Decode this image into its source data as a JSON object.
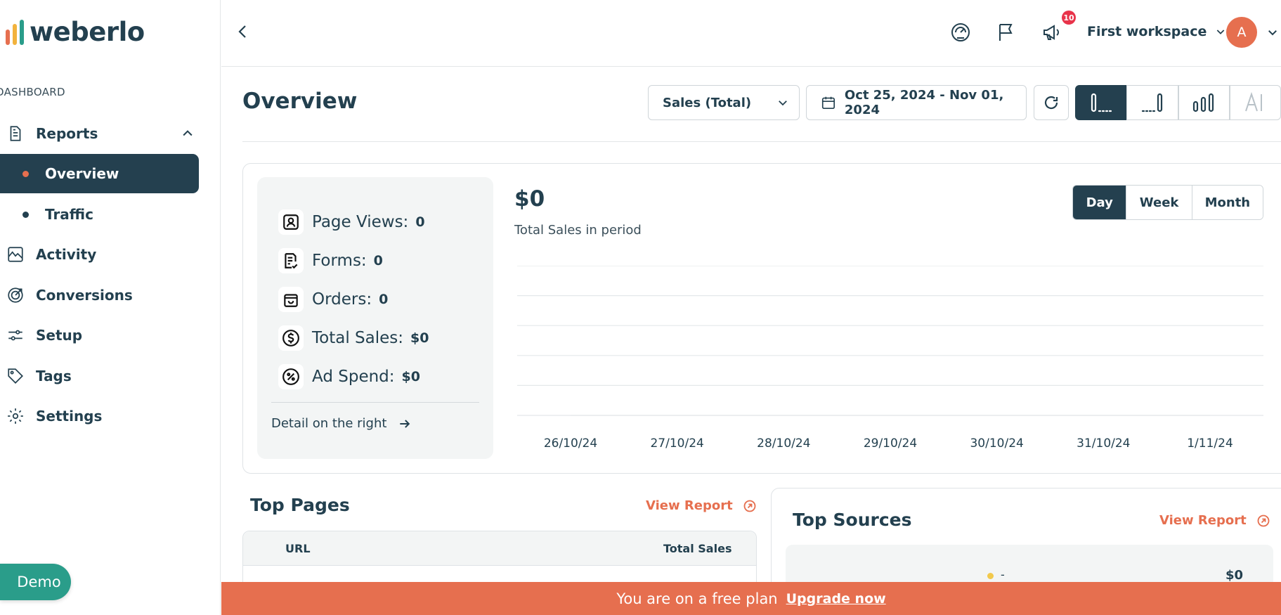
{
  "brand": {
    "name": "weberlo",
    "bar_colors": [
      "#e66f4f",
      "#f2b33d",
      "#2a9d8a"
    ]
  },
  "sidebar": {
    "section_label": "DASHBOARD",
    "items": [
      {
        "label": "Reports",
        "icon": "document-icon",
        "expanded": true
      },
      {
        "label": "Overview",
        "active": true
      },
      {
        "label": "Traffic"
      },
      {
        "label": "Activity",
        "icon": "activity-chart-icon"
      },
      {
        "label": "Conversions",
        "icon": "target-icon"
      },
      {
        "label": "Setup",
        "icon": "sliders-icon"
      },
      {
        "label": "Tags",
        "icon": "tag-icon"
      },
      {
        "label": "Settings",
        "icon": "gear-icon"
      }
    ],
    "demo_label": "Demo"
  },
  "header": {
    "notification_count": "10",
    "workspace": "First workspace",
    "avatar_initial": "A"
  },
  "page": {
    "title": "Overview",
    "metric_select": "Sales (Total)",
    "date_range": "Oct 25, 2024 - Nov 01, 2024",
    "view_options": [
      "first-bar",
      "last-bar",
      "all-bars",
      "AI"
    ]
  },
  "stats": [
    {
      "label": "Page Views:",
      "value": "0",
      "icon": "user-square-icon"
    },
    {
      "label": "Forms:",
      "value": "0",
      "icon": "form-check-icon"
    },
    {
      "label": "Orders:",
      "value": "0",
      "icon": "bag-icon"
    },
    {
      "label": "Total Sales:",
      "value": "$0",
      "icon": "dollar-circle-icon"
    },
    {
      "label": "Ad Spend:",
      "value": "$0",
      "icon": "percent-circle-icon"
    }
  ],
  "detail_link": "Detail on the right",
  "summary": {
    "total_value": "$0",
    "total_label": "Total Sales in period"
  },
  "period": {
    "options": [
      "Day",
      "Week",
      "Month"
    ],
    "selected": "Day"
  },
  "chart_data": {
    "type": "line",
    "x": [
      "26/10/24",
      "27/10/24",
      "28/10/24",
      "29/10/24",
      "30/10/24",
      "31/10/24",
      "1/11/24"
    ],
    "series": [
      {
        "values": [
          0,
          0,
          0,
          0,
          0,
          0,
          0
        ]
      }
    ],
    "grid": true,
    "title": "",
    "xlabel": "",
    "ylabel": ""
  },
  "top_pages": {
    "title": "Top Pages",
    "view_report": "View Report",
    "columns": [
      "URL",
      "Total Sales"
    ]
  },
  "top_sources": {
    "title": "Top Sources",
    "view_report": "View Report",
    "rows": [
      {
        "name": "-",
        "value": "$0"
      }
    ]
  },
  "banner": {
    "text": "You are on a free plan",
    "link": "Upgrade now"
  },
  "colors": {
    "primary": "#24404f",
    "accent": "#e66f4f",
    "teal": "#2a9d8a"
  }
}
